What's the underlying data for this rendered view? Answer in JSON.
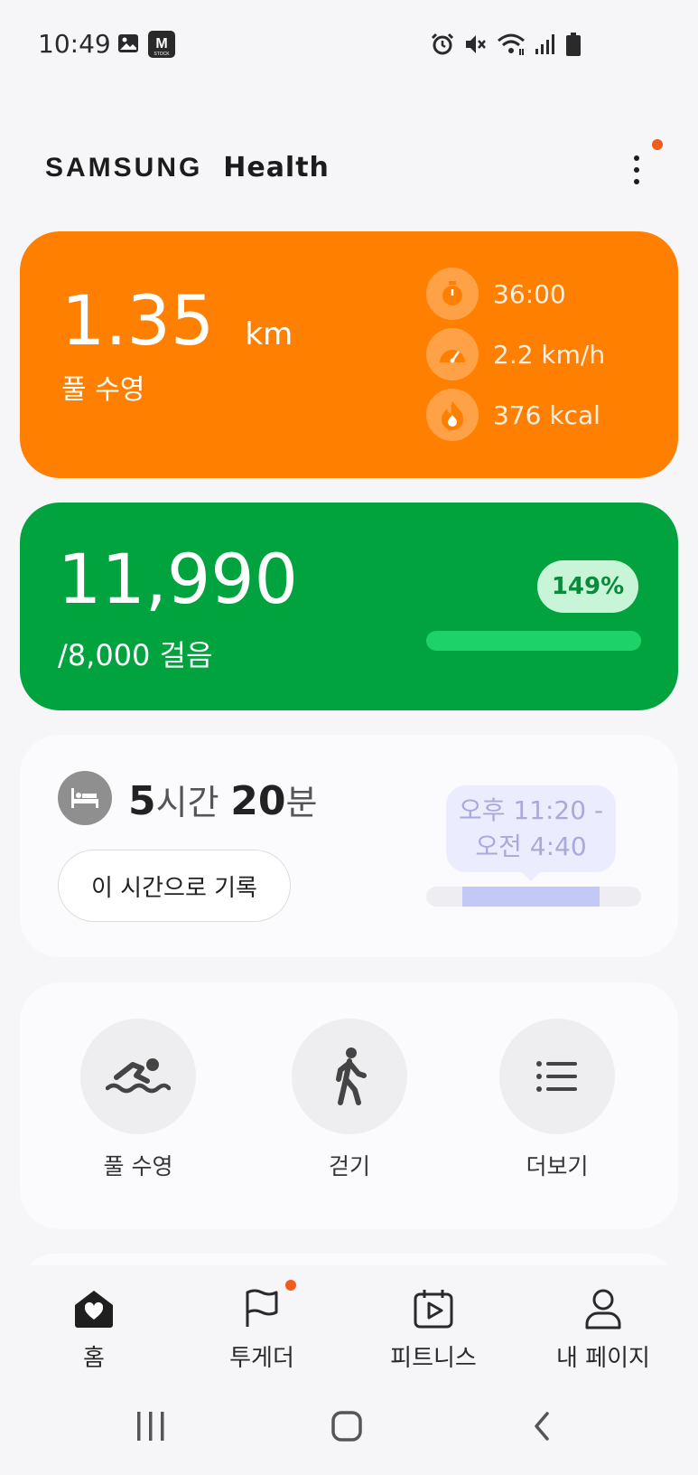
{
  "status_bar": {
    "time": "10:49"
  },
  "header": {
    "brand_left": "SAMSUNG",
    "brand_right": "Health"
  },
  "workout_card": {
    "distance": "1.35",
    "unit": "km",
    "activity": "풀 수영",
    "metrics": [
      {
        "icon": "stopwatch-icon",
        "text": "36:00"
      },
      {
        "icon": "speedometer-icon",
        "text": "2.2 km/h"
      },
      {
        "icon": "flame-icon",
        "text": "376 kcal"
      }
    ],
    "color": "#ff7f00"
  },
  "steps_card": {
    "steps": "11,990",
    "goal_text": "/8,000 걸음",
    "percent": "149%",
    "progress": 1.0,
    "color": "#00a33e"
  },
  "sleep_card": {
    "hours": "5",
    "hours_unit": "시간",
    "minutes": "20",
    "minutes_unit": "분",
    "record_button": "이 시간으로 기록",
    "range_line1": "오후 11:20 -",
    "range_line2": "오전 4:40"
  },
  "shortcuts": [
    {
      "icon": "swimming-icon",
      "label": "풀 수영"
    },
    {
      "icon": "walking-icon",
      "label": "걷기"
    },
    {
      "icon": "list-icon",
      "label": "더보기"
    }
  ],
  "bottom_nav": [
    {
      "icon": "home-heart-icon",
      "label": "홈",
      "active": true
    },
    {
      "icon": "flag-icon",
      "label": "투게더",
      "badge": true
    },
    {
      "icon": "calendar-play-icon",
      "label": "피트니스"
    },
    {
      "icon": "person-icon",
      "label": "내 페이지"
    }
  ],
  "accent_colors": {
    "notification_dot": "#f25b1e",
    "sleep_bar": "#c4c8f6"
  }
}
